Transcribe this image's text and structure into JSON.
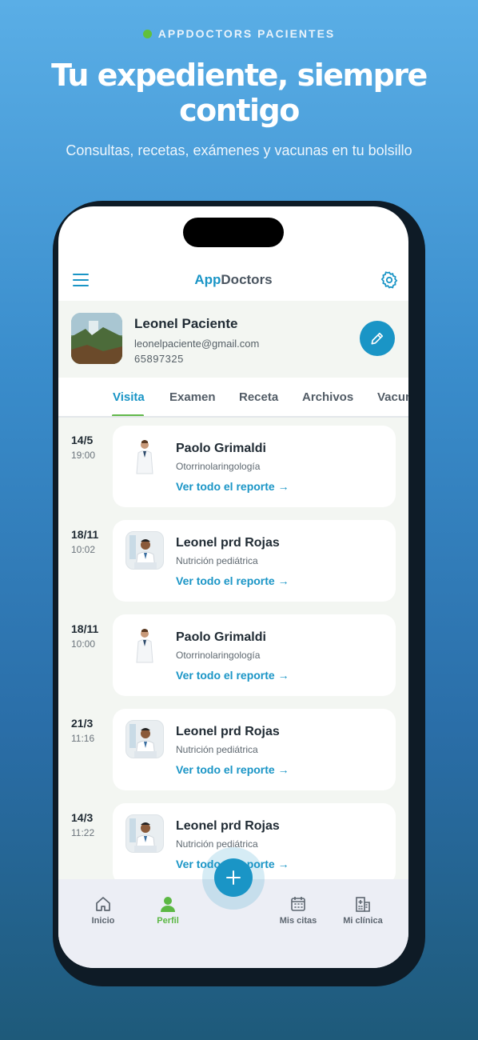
{
  "hero": {
    "badge": "APPDOCTORS PACIENTES",
    "headline": "Tu expediente, siempre contigo",
    "subtitle": "Consultas, recetas, exámenes y vacunas en tu bolsillo"
  },
  "app": {
    "title_accent": "App",
    "title_rest": "Doctors"
  },
  "profile": {
    "name": "Leonel Paciente",
    "email": "leonelpaciente@gmail.com",
    "phone": "65897325"
  },
  "tabs": [
    {
      "label": "Visita",
      "active": true
    },
    {
      "label": "Examen",
      "active": false
    },
    {
      "label": "Receta",
      "active": false
    },
    {
      "label": "Archivos",
      "active": false
    },
    {
      "label": "Vacunas",
      "active": false
    }
  ],
  "visits": [
    {
      "date": "14/5",
      "time": "19:00",
      "doctor": "Paolo Grimaldi",
      "specialty": "Otorrinolaringología",
      "link": "Ver todo el reporte →"
    },
    {
      "date": "18/11",
      "time": "10:02",
      "doctor": "Leonel prd Rojas",
      "specialty": "Nutrición pediátrica",
      "link": "Ver todo el reporte →"
    },
    {
      "date": "18/11",
      "time": "10:00",
      "doctor": "Paolo Grimaldi",
      "specialty": "Otorrinolaringología",
      "link": "Ver todo el reporte →"
    },
    {
      "date": "21/3",
      "time": "11:16",
      "doctor": "Leonel prd Rojas",
      "specialty": "Nutrición pediátrica",
      "link": "Ver todo el reporte →"
    },
    {
      "date": "14/3",
      "time": "11:22",
      "doctor": "Leonel prd Rojas",
      "specialty": "Nutrición pediátrica",
      "link": "Ver todo el reporte →"
    }
  ],
  "bottom_nav": [
    {
      "label": "Inicio",
      "icon": "home-icon",
      "active": false
    },
    {
      "label": "Perfil",
      "icon": "person-icon",
      "active": true
    },
    {
      "label": "Mis citas",
      "icon": "calendar-icon",
      "active": false
    },
    {
      "label": "Mi clínica",
      "icon": "hospital-icon",
      "active": false
    }
  ],
  "colors": {
    "accent": "#1a95c6",
    "active_green": "#5cb844"
  }
}
